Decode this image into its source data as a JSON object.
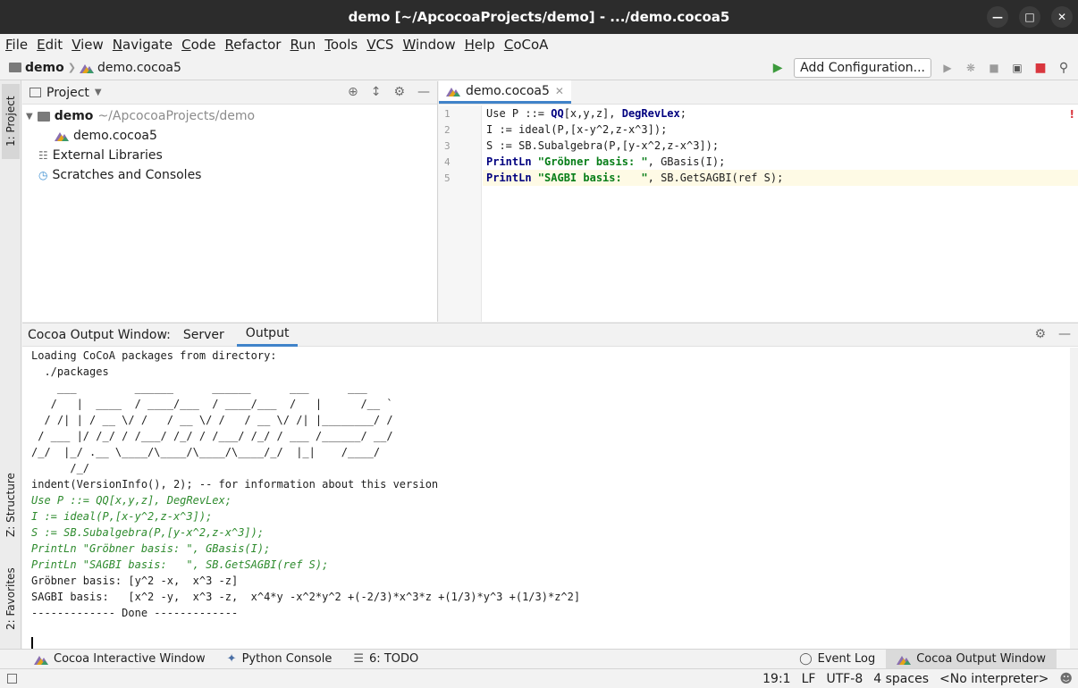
{
  "window": {
    "title": "demo [~/ApcocoaProjects/demo] - .../demo.cocoa5"
  },
  "menu": [
    "File",
    "Edit",
    "View",
    "Navigate",
    "Code",
    "Refactor",
    "Run",
    "Tools",
    "VCS",
    "Window",
    "Help",
    "CoCoA"
  ],
  "breadcrumb": {
    "project": "demo",
    "file": "demo.cocoa5"
  },
  "toolbar": {
    "add_config": "Add Configuration..."
  },
  "left_tabs": {
    "project": "1: Project",
    "structure": "Z: Structure",
    "favorites": "2: Favorites"
  },
  "project_panel": {
    "title": "Project",
    "root_name": "demo",
    "root_path": "~/ApcocoaProjects/demo",
    "file": "demo.cocoa5",
    "external": "External Libraries",
    "scratches": "Scratches and Consoles"
  },
  "editor": {
    "tab": "demo.cocoa5",
    "lines": [
      {
        "no": "1",
        "parts": [
          [
            "Use P ::= ",
            ""
          ],
          [
            "QQ",
            "kw"
          ],
          [
            "[x,y,z], ",
            ""
          ],
          [
            "DegRevLex",
            "kw"
          ],
          [
            ";",
            ""
          ]
        ]
      },
      {
        "no": "2",
        "parts": [
          [
            "I := ideal(P,[x-y^2,z-x^3]);",
            ""
          ]
        ]
      },
      {
        "no": "3",
        "parts": [
          [
            "S := SB.Subalgebra(P,[y-x^2,z-x^3]);",
            ""
          ]
        ]
      },
      {
        "no": "4",
        "parts": [
          [
            "PrintLn ",
            "kw"
          ],
          [
            "\"Gröbner basis: \"",
            "str"
          ],
          [
            ", GBasis(I);",
            ""
          ]
        ]
      },
      {
        "no": "5",
        "parts": [
          [
            "PrintLn ",
            "kw"
          ],
          [
            "\"SAGBI basis:   \"",
            "str"
          ],
          [
            ", SB.GetSAGBI(ref S);",
            ""
          ]
        ]
      }
    ]
  },
  "output": {
    "label": "Cocoa Output Window:",
    "tab_server": "Server",
    "tab_output": "Output",
    "lines": [
      {
        "t": "Loading CoCoA packages from directory:",
        "c": ""
      },
      {
        "t": "  ./packages",
        "c": ""
      },
      {
        "t": "    ___         ______      ______      ___      ___",
        "c": ""
      },
      {
        "t": "   /   |  ____  / ____/___  / ____/___  /   |      /__ `",
        "c": ""
      },
      {
        "t": "  / /| | / __ \\/ /   / __ \\/ /   / __ \\/ /| |________/ /",
        "c": ""
      },
      {
        "t": " / ___ |/ /_/ / /___/ /_/ / /___/ /_/ / ___ /______/ __/",
        "c": ""
      },
      {
        "t": "/_/  |_/ .__ \\____/\\____/\\____/\\____/_/  |_|    /____/",
        "c": ""
      },
      {
        "t": "      /_/",
        "c": ""
      },
      {
        "t": "indent(VersionInfo(), 2); -- for information about this version",
        "c": ""
      },
      {
        "t": "Use P ::= QQ[x,y,z], DegRevLex;",
        "c": "echo"
      },
      {
        "t": "I := ideal(P,[x-y^2,z-x^3]);",
        "c": "echo"
      },
      {
        "t": "S := SB.Subalgebra(P,[y-x^2,z-x^3]);",
        "c": "echo"
      },
      {
        "t": "PrintLn \"Gröbner basis: \", GBasis(I);",
        "c": "echo"
      },
      {
        "t": "PrintLn \"SAGBI basis:   \", SB.GetSAGBI(ref S);",
        "c": "echo"
      },
      {
        "t": "Gröbner basis: [y^2 -x,  x^3 -z]",
        "c": ""
      },
      {
        "t": "SAGBI basis:   [x^2 -y,  x^3 -z,  x^4*y -x^2*y^2 +(-2/3)*x^3*z +(1/3)*y^3 +(1/3)*z^2]",
        "c": ""
      },
      {
        "t": "------------- Done -------------",
        "c": ""
      }
    ]
  },
  "bottom_tools": {
    "interactive": "Cocoa Interactive Window",
    "python": "Python Console",
    "todo": "6: TODO",
    "event_log": "Event Log",
    "output_window": "Cocoa Output Window"
  },
  "status": {
    "pos": "19:1",
    "lf": "LF",
    "enc": "UTF-8",
    "indent": "4 spaces",
    "interp": "<No interpreter>"
  }
}
